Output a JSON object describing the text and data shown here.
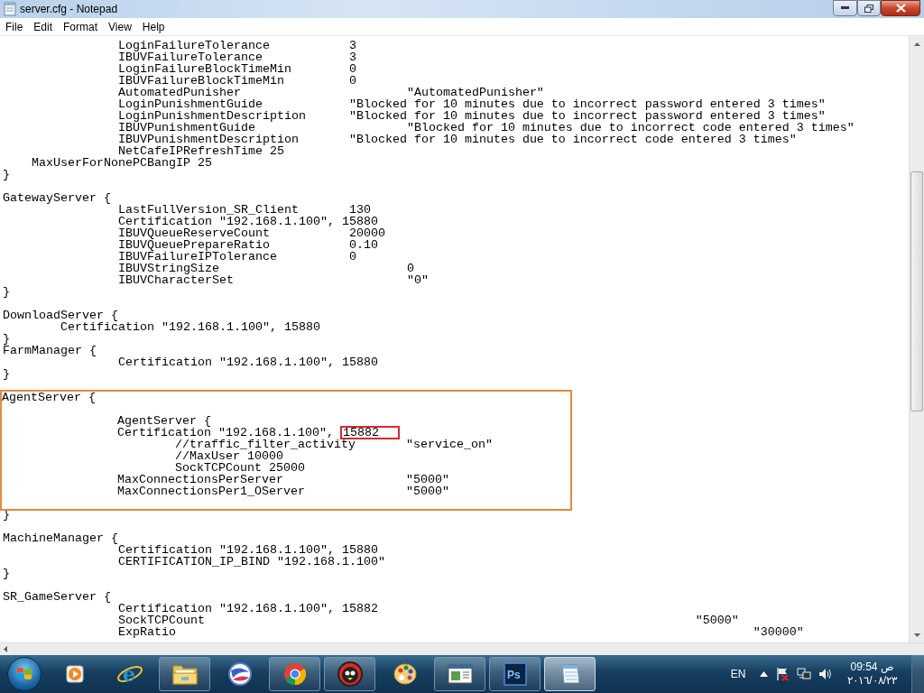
{
  "window": {
    "title": "server.cfg - Notepad"
  },
  "menu": [
    "File",
    "Edit",
    "Format",
    "View",
    "Help"
  ],
  "document": [
    {
      "kind": "plain",
      "lines": [
        {
          "kind": "text",
          "text": "\t\tLoginFailureTolerance\t\t3"
        },
        {
          "kind": "text",
          "text": "\t\tIBUVFailureTolerance\t\t3"
        },
        {
          "kind": "text",
          "text": "\t\tLoginFailureBlockTimeMin\t0"
        },
        {
          "kind": "text",
          "text": "\t\tIBUVFailureBlockTimeMin\t\t0"
        },
        {
          "kind": "text",
          "text": "\t\tAutomatedPunisher\t\t\t\"AutomatedPunisher\""
        },
        {
          "kind": "text",
          "text": "\t\tLoginPunishmentGuide\t\t\"Blocked for 10 minutes due to incorrect password entered 3 times\""
        },
        {
          "kind": "text",
          "text": "\t\tLoginPunishmentDescription\t\"Blocked for 10 minutes due to incorrect password entered 3 times\""
        },
        {
          "kind": "text",
          "text": "\t\tIBUVPunishmentGuide\t\t\t\"Blocked for 10 minutes due to incorrect code entered 3 times\""
        },
        {
          "kind": "text",
          "text": "\t\tIBUVPunishmentDescription\t\"Blocked for 10 minutes due to incorrect code entered 3 times\""
        },
        {
          "kind": "text",
          "text": "\t\tNetCafeIPRefreshTime 25"
        },
        {
          "kind": "text",
          "text": "    MaxUserForNonePCBangIP 25"
        },
        {
          "kind": "text",
          "text": "}"
        },
        {
          "kind": "blank"
        },
        {
          "kind": "text",
          "text": "GatewayServer {"
        },
        {
          "kind": "text",
          "text": "\t\tLastFullVersion_SR_Client\t130"
        },
        {
          "kind": "text",
          "text": "\t\tCertification \"192.168.1.100\", 15880"
        },
        {
          "kind": "text",
          "text": "\t\tIBUVQueueReserveCount\t\t20000"
        },
        {
          "kind": "text",
          "text": "\t\tIBUVQueuePrepareRatio\t\t0.10"
        },
        {
          "kind": "text",
          "text": "\t\tIBUVFailureIPTolerance\t\t0"
        },
        {
          "kind": "text",
          "text": "\t\tIBUVStringSize\t\t\t\t0"
        },
        {
          "kind": "text",
          "text": "\t\tIBUVCharacterSet\t\t\t\"0\""
        },
        {
          "kind": "text",
          "text": "}"
        },
        {
          "kind": "blank"
        },
        {
          "kind": "text",
          "text": "DownloadServer {"
        },
        {
          "kind": "text",
          "text": "\tCertification \"192.168.1.100\", 15880"
        },
        {
          "kind": "text",
          "text": "}"
        },
        {
          "kind": "text",
          "text": "FarmManager {"
        },
        {
          "kind": "text",
          "text": "\t\tCertification \"192.168.1.100\", 15880"
        },
        {
          "kind": "text",
          "text": "}"
        },
        {
          "kind": "blank"
        }
      ]
    },
    {
      "kind": "framed",
      "lines": [
        {
          "kind": "text",
          "text": "AgentServer {"
        },
        {
          "kind": "blank"
        },
        {
          "kind": "text",
          "text": "\t\tAgentServer {"
        },
        {
          "kind": "text",
          "text": "\t\tCertification \"192.168.1.100\", ",
          "marked": "15882"
        },
        {
          "kind": "text",
          "text": "\t\t\t//traffic_filter_activity\t\"service_on\""
        },
        {
          "kind": "text",
          "text": "\t\t\t//MaxUser 10000"
        },
        {
          "kind": "text",
          "text": "\t\t\tSockTCPCount 25000"
        },
        {
          "kind": "text",
          "text": "\t\tMaxConnectionsPerServer\t\t\t\"5000\""
        },
        {
          "kind": "text",
          "text": "\t\tMaxConnectionsPer1_OServer\t\t\"5000\""
        },
        {
          "kind": "blank"
        }
      ]
    },
    {
      "kind": "plain",
      "lines": [
        {
          "kind": "text",
          "text": "}"
        },
        {
          "kind": "blank"
        },
        {
          "kind": "text",
          "text": "MachineManager {"
        },
        {
          "kind": "text",
          "text": "\t\tCertification \"192.168.1.100\", 15880"
        },
        {
          "kind": "text",
          "text": "\t\tCERTIFICATION_IP_BIND \"192.168.1.100\""
        },
        {
          "kind": "text",
          "text": "}"
        },
        {
          "kind": "blank"
        },
        {
          "kind": "text",
          "text": "SR_GameServer {"
        },
        {
          "kind": "text",
          "text": "\t\tCertification \"192.168.1.100\", 15882"
        },
        {
          "kind": "text",
          "text": "\t\tSockTCPCount\t\t\t\t\t\t\t\t\t\"5000\""
        },
        {
          "kind": "text",
          "text": "\t\tExpRatio\t\t\t\t\t\t\t\t\t\t\"30000\""
        }
      ]
    }
  ],
  "taskbar": {
    "buttons": [
      {
        "running": false,
        "selected": false
      },
      {
        "running": false,
        "selected": false,
        "glyph": "e"
      },
      {
        "running": true,
        "selected": false
      },
      {
        "running": false,
        "selected": false
      },
      {
        "running": true,
        "selected": false
      },
      {
        "running": true,
        "selected": false
      },
      {
        "running": false,
        "selected": false
      },
      {
        "running": true,
        "selected": false
      },
      {
        "running": true,
        "selected": false,
        "glyph": "Ps"
      },
      {
        "running": true,
        "selected": true
      }
    ],
    "tray": {
      "language": "EN",
      "time": "09:54 ص",
      "date": "٢٠١٦/٠٨/٢٣"
    }
  }
}
